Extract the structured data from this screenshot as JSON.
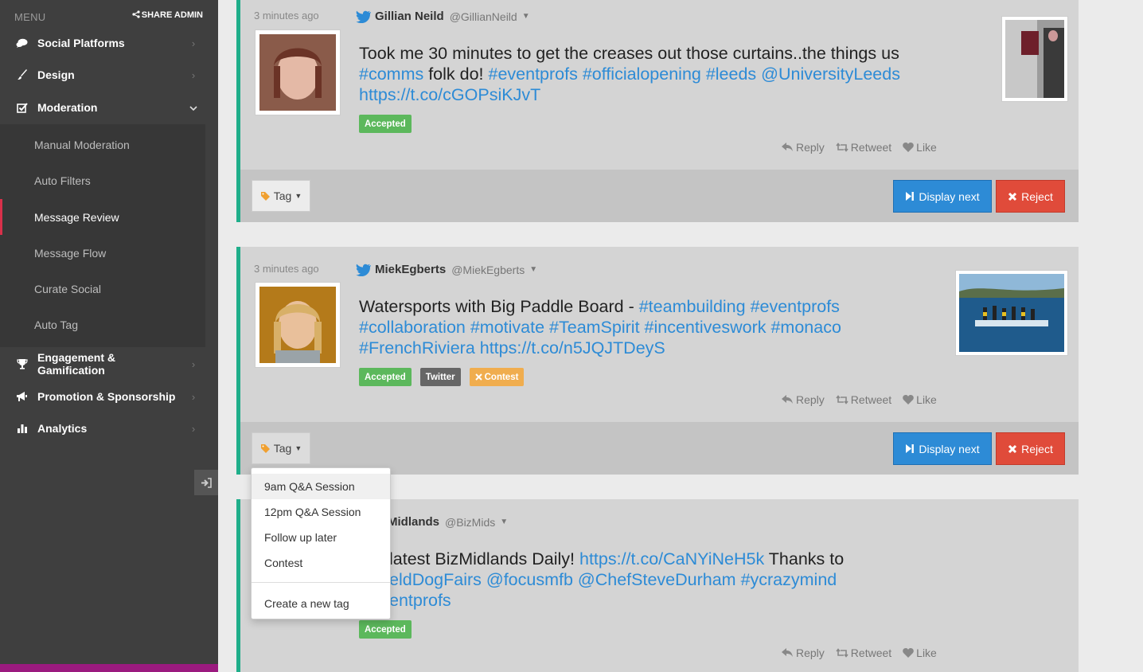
{
  "sidebar": {
    "menu_label": "MENU",
    "share_admin": "SHARE ADMIN",
    "items": [
      {
        "label": "Social Platforms",
        "icon": "chat-bubble-icon"
      },
      {
        "label": "Design",
        "icon": "brush-icon"
      },
      {
        "label": "Moderation",
        "icon": "check-square-icon"
      },
      {
        "label": "Engagement & Gamification",
        "icon": "trophy-icon"
      },
      {
        "label": "Promotion & Sponsorship",
        "icon": "megaphone-icon"
      },
      {
        "label": "Analytics",
        "icon": "bar-chart-icon"
      }
    ],
    "moderation_sub": [
      {
        "label": "Manual Moderation"
      },
      {
        "label": "Auto Filters"
      },
      {
        "label": "Message Review",
        "active": true
      },
      {
        "label": "Message Flow"
      },
      {
        "label": "Curate Social"
      },
      {
        "label": "Auto Tag"
      }
    ]
  },
  "posts": [
    {
      "time": "3 minutes ago",
      "name": "Gillian Neild",
      "handle": "@GillianNeild",
      "text_plain_1": "Took me 30 minutes to get the creases out those curtains..the things us",
      "link_1": "#comms",
      "text_plain_2": " folk do! ",
      "links_2": "#eventprofs #officialopening #leeds @UniversityLeeds",
      "link_3": "https://t.co/cGOPsiKJvT",
      "badges": [
        "Accepted"
      ]
    },
    {
      "time": "3 minutes ago",
      "name": "MiekEgberts",
      "handle": "@MiekEgberts",
      "text_plain_1": "Watersports with Big Paddle Board - ",
      "links_1": "#teambuilding #eventprofs",
      "links_2": "#collaboration #motivate #TeamSpirit #incentiveswork #monaco",
      "links_3": "#FrenchRiviera https://t.co/n5JQJTDeyS",
      "badges": [
        "Accepted",
        "Twitter",
        "Contest"
      ]
    },
    {
      "name": "Midlands",
      "handle": "@BizMids",
      "text_plain_1": "latest BizMidlands Daily! ",
      "link_1": "https://t.co/CaNYiNeH5k",
      "text_plain_2": " Thanks to",
      "links_2": "eldDogFairs @focusmfb @ChefSteveDurham #ycrazymind",
      "links_3": "entprofs",
      "badges": [
        "Accepted"
      ]
    }
  ],
  "actions": {
    "reply": "Reply",
    "retweet": "Retweet",
    "like": "Like"
  },
  "footer": {
    "tag": "Tag",
    "display_next": "Display next",
    "reject": "Reject"
  },
  "tag_dropdown": {
    "items": [
      "9am Q&A Session",
      "12pm Q&A Session",
      "Follow up later",
      "Contest"
    ],
    "create": "Create a new tag"
  },
  "colors": {
    "accent": "#1fae8a",
    "link": "#2d8bd6",
    "display": "#2d8bd6",
    "reject": "#e04b3a",
    "accepted": "#5cb85c",
    "contest": "#f0ad4e"
  }
}
